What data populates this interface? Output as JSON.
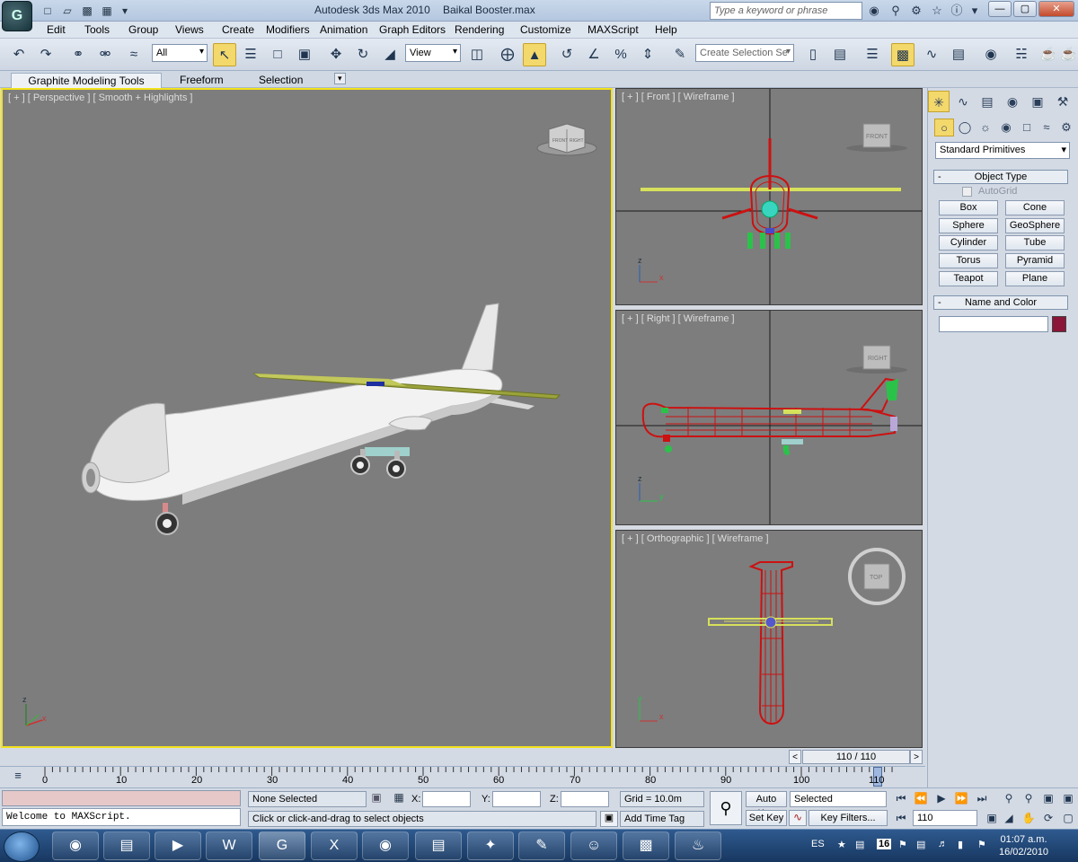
{
  "titlebar": {
    "app_title": "Autodesk 3ds Max  2010",
    "file_name": "Baikal Booster.max",
    "search_placeholder": "Type a keyword or phrase"
  },
  "menu": [
    "Edit",
    "Tools",
    "Group",
    "Views",
    "Create",
    "Modifiers",
    "Animation",
    "Graph Editors",
    "Rendering",
    "Customize",
    "MAXScript",
    "Help"
  ],
  "toolbar": {
    "selection_filter": "All",
    "ref_coord": "View",
    "named_selection_placeholder": "Create Selection Se"
  },
  "ribbon_tabs": [
    "Graphite Modeling Tools",
    "Freeform",
    "Selection"
  ],
  "viewports": {
    "perspective": "[ + ] [ Perspective ] [ Smooth + Highlights ]",
    "front": "[ + ] [ Front ] [ Wireframe ]",
    "right": "[ + ] [ Right ] [ Wireframe ]",
    "ortho": "[ + ] [ Orthographic ] [ Wireframe ]",
    "cube_front": "FRONT",
    "cube_right": "RIGHT",
    "cube_top": "TOP",
    "cube_persp_left": "FRONT",
    "cube_persp_right": "RIGHT"
  },
  "command_panel": {
    "category": "Standard Primitives",
    "object_type_title": "Object Type",
    "autogrid": "AutoGrid",
    "buttons": [
      "Box",
      "Cone",
      "Sphere",
      "GeoSphere",
      "Cylinder",
      "Tube",
      "Torus",
      "Pyramid",
      "Teapot",
      "Plane"
    ],
    "name_color_title": "Name and Color",
    "object_color": "#8b1538"
  },
  "time": {
    "frame_display": "110 / 110",
    "ticks": [
      "0",
      "10",
      "20",
      "30",
      "40",
      "50",
      "60",
      "70",
      "80",
      "90",
      "100",
      "110"
    ],
    "current_frame": "110"
  },
  "status": {
    "maxscript_output": "Welcome to MAXScript.",
    "selection": "None Selected",
    "prompt": "Click or click-and-drag to select objects",
    "x_label": "X:",
    "y_label": "Y:",
    "z_label": "Z:",
    "grid": "Grid = 10.0m",
    "add_time_tag": "Add Time Tag",
    "auto_key": "Auto Key",
    "set_key": "Set Key",
    "key_mode": "Selected",
    "key_filters": "Key Filters..."
  },
  "taskbar": {
    "lang": "ES",
    "tray_number": "16",
    "time": "01:07 a.m.",
    "date": "16/02/2010"
  },
  "colors": {
    "active_viewport_border": "#f2e21c",
    "viewport_bg": "#7d7d7d",
    "wire_red": "#cc1111",
    "wing_yellow": "#d6e05a"
  }
}
